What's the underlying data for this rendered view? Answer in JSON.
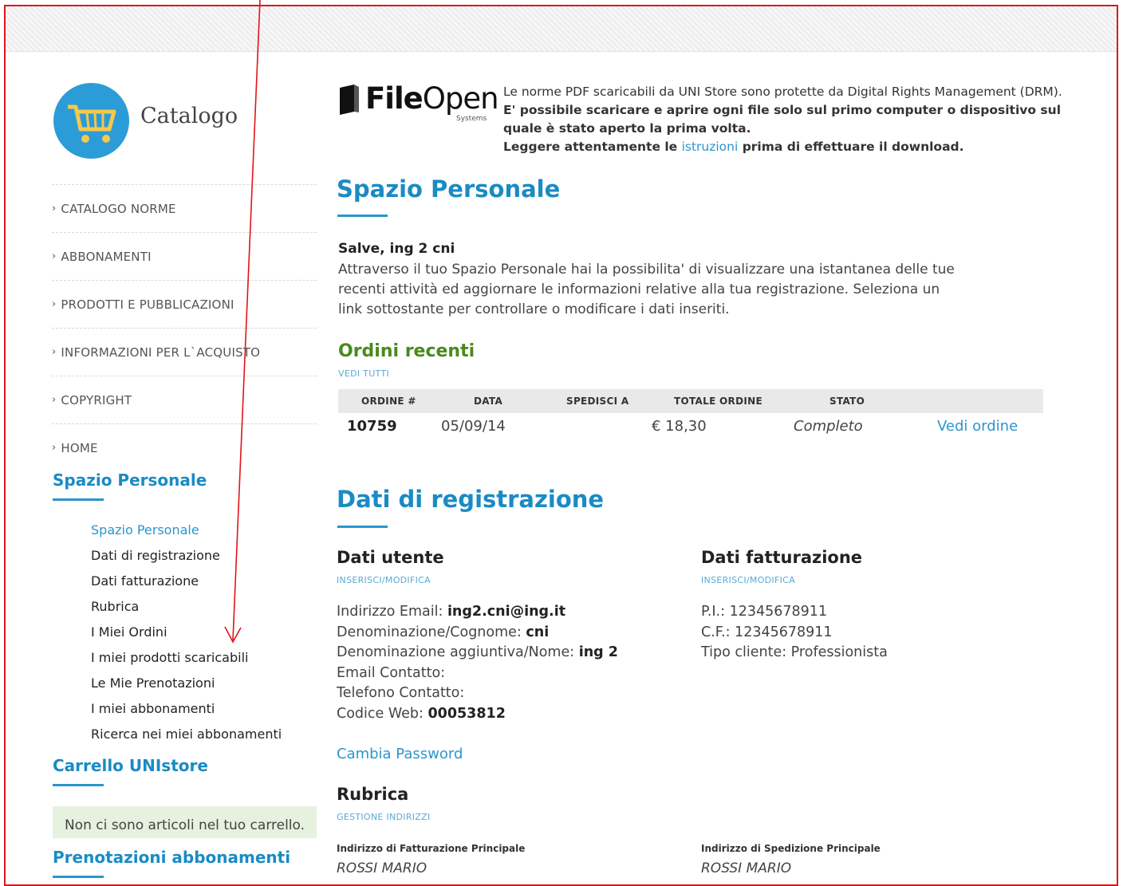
{
  "sidebar": {
    "logo_text": "Catalogo",
    "nav": [
      {
        "label": "CATALOGO NORME"
      },
      {
        "label": "ABBONAMENTI"
      },
      {
        "label": "PRODOTTI E PUBBLICAZIONI"
      },
      {
        "label": "INFORMAZIONI PER L`ACQUISTO"
      },
      {
        "label": "COPYRIGHT"
      },
      {
        "label": "HOME"
      }
    ],
    "section_personal": "Spazio Personale",
    "sub_items": [
      {
        "label": "Spazio Personale"
      },
      {
        "label": "Dati di registrazione"
      },
      {
        "label": "Dati fatturazione"
      },
      {
        "label": "Rubrica"
      },
      {
        "label": "I Miei Ordini"
      },
      {
        "label": "I miei prodotti scaricabili"
      },
      {
        "label": "Le Mie Prenotazioni"
      },
      {
        "label": "I miei abbonamenti"
      },
      {
        "label": "Ricerca nei miei abbonamenti"
      }
    ],
    "section_cart": "Carrello UNIstore",
    "cart_empty": "Non ci sono articoli nel tuo carrello.",
    "section_bookings": "Prenotazioni abbonamenti"
  },
  "fileopen": {
    "word_bold": "File",
    "word_light": "Open",
    "systems": "Systems",
    "line1": "Le norme PDF scaricabili da UNI Store sono protette da Digital Rights Management (DRM).",
    "line2": "E' possibile scaricare e aprire ogni file solo sul primo computer o dispositivo sul",
    "line3": "quale è stato aperto la prima volta.",
    "line4_pre": "Leggere attentamente le ",
    "line4_link": "istruzioni",
    "line4_post": " prima di effettuare il download."
  },
  "main": {
    "title": "Spazio Personale",
    "greeting": "Salve, ing 2 cni",
    "intro": "Attraverso il tuo Spazio Personale hai la possibilita' di visualizzare una istantanea delle tue recenti attività ed aggiornare le informazioni relative alla tua registrazione. Seleziona un link sottostante per controllare o modificare i dati inseriti.",
    "orders": {
      "title": "Ordini recenti",
      "view_all": "VEDI TUTTI",
      "columns": [
        "ORDINE #",
        "DATA",
        "SPEDISCI A",
        "TOTALE ORDINE",
        "STATO"
      ],
      "rows": [
        {
          "id": "10759",
          "date": "05/09/14",
          "ship_to": "",
          "total": "€ 18,30",
          "status": "Completo",
          "action": "Vedi ordine"
        }
      ]
    },
    "registration": {
      "title": "Dati di registrazione",
      "user": {
        "title": "Dati utente",
        "edit": "INSERISCI/MODIFICA",
        "email_label": "Indirizzo Email: ",
        "email": "ing2.cni@ing.it",
        "surname_label": "Denominazione/Cognome: ",
        "surname": "cni",
        "name_label": "Denominazione aggiuntiva/Nome: ",
        "name": "ing 2",
        "contact_email": "Email Contatto:",
        "contact_phone": "Telefono Contatto:",
        "webcode_label": "Codice Web: ",
        "webcode": "00053812",
        "change_password": "Cambia Password"
      },
      "billing": {
        "title": "Dati fatturazione",
        "edit": "INSERISCI/MODIFICA",
        "vat": "P.I.: 12345678911",
        "tax_code": "C.F.: 12345678911",
        "customer_type": "Tipo cliente: Professionista"
      },
      "address_book": {
        "title": "Rubrica",
        "manage": "GESTIONE INDIRIZZI",
        "billing_head": "Indirizzo di Fatturazione Principale",
        "billing_name": "ROSSI MARIO",
        "shipping_head": "Indirizzo di Spedizione Principale",
        "shipping_name": "ROSSI MARIO"
      }
    }
  },
  "colors": {
    "accent_blue": "#1a8bc4",
    "green": "#4a8a1c",
    "annotation_red": "#e0141b"
  }
}
